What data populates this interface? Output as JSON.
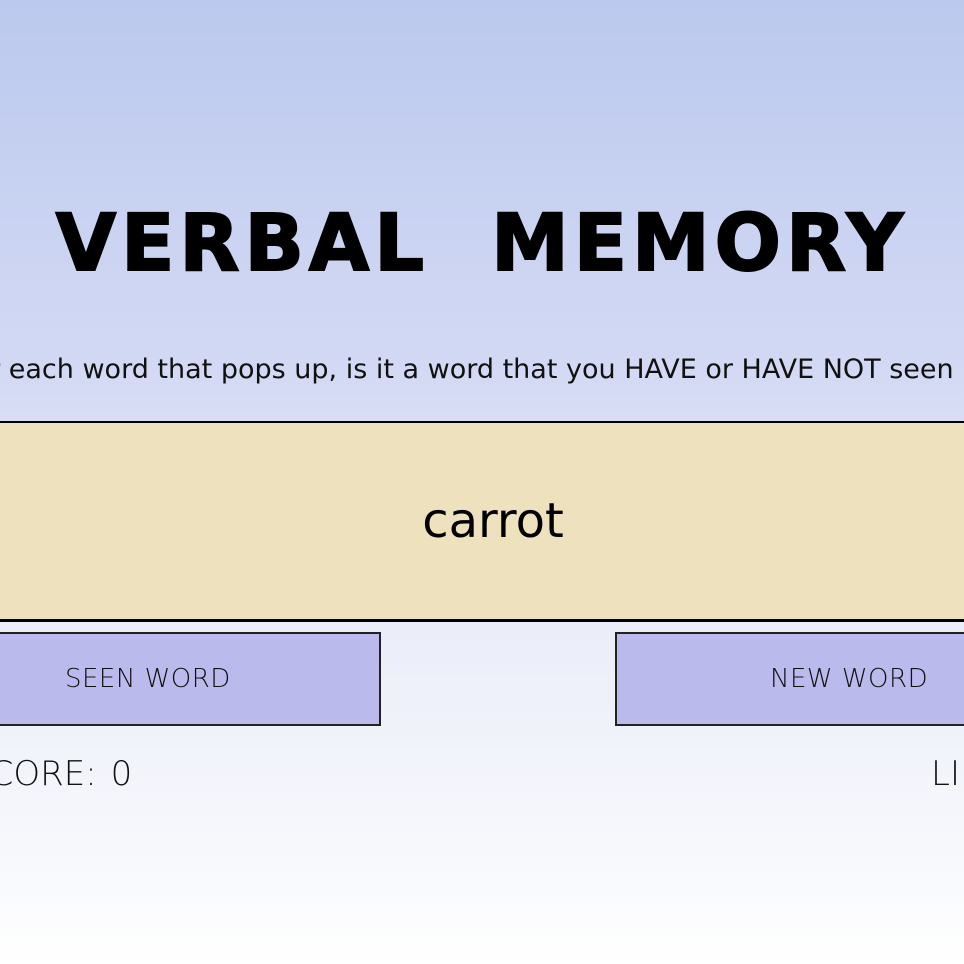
{
  "game": {
    "title": "VERBAL MEMORY",
    "instructions": "For each word that pops up, is it a word that you HAVE or HAVE NOT seen",
    "current_word": "carrot",
    "buttons": {
      "seen_label": "SEEN WORD",
      "new_label": "NEW WORD"
    },
    "score": {
      "label": "SCORE:",
      "value": "0"
    },
    "lives": {
      "label": "LI"
    }
  },
  "colors": {
    "background_top": "#bbc9ee",
    "background_bottom": "#ffffff",
    "word_panel": "#ede2bd",
    "button": "#bbbaed"
  }
}
